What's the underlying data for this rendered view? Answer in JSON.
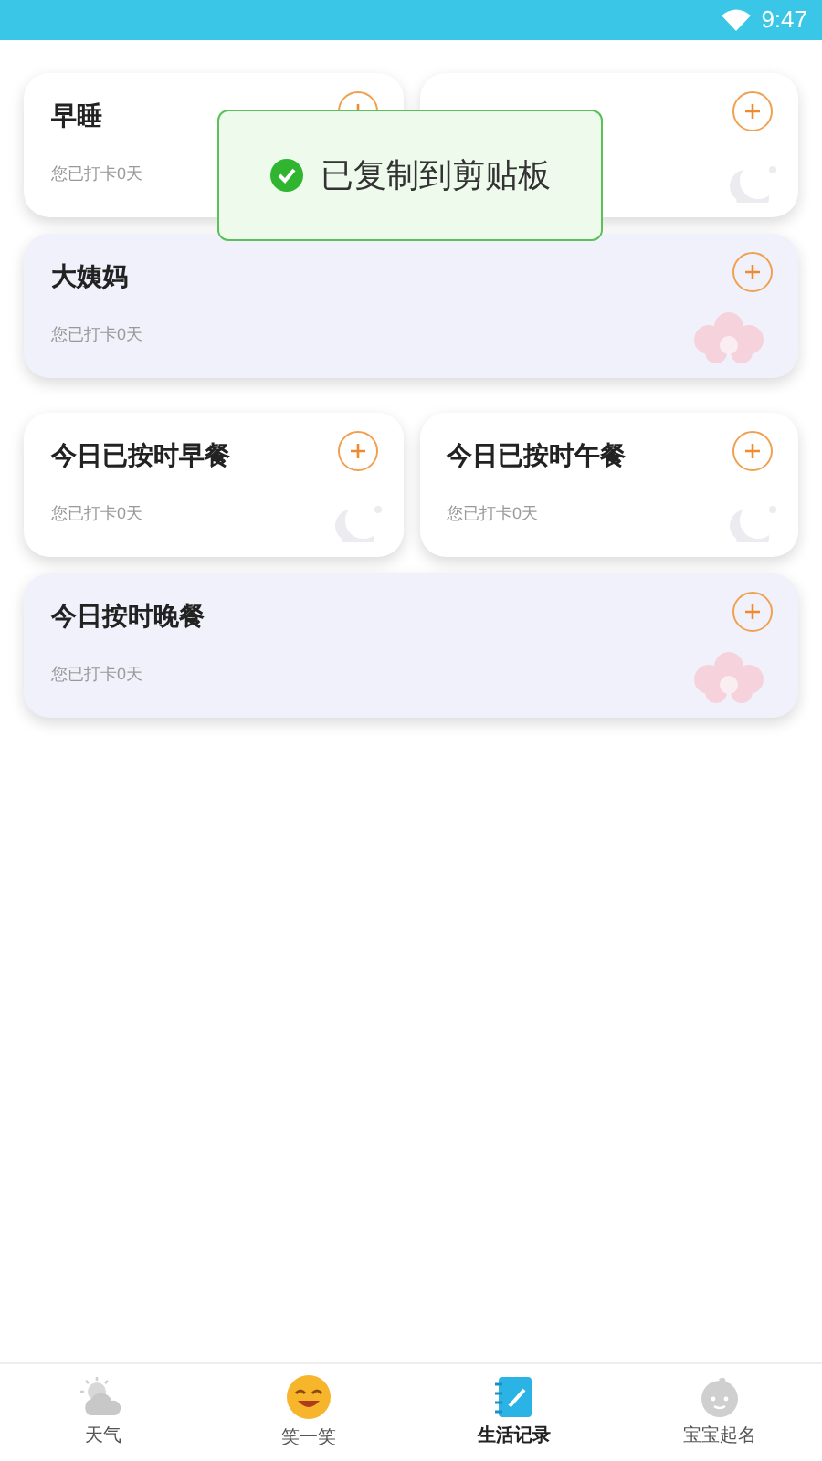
{
  "status_bar": {
    "time": "9:47"
  },
  "card_rows": [
    {
      "cards": [
        {
          "title": "早睡",
          "subtitle": "您已打卡0天",
          "kind": "plain"
        },
        {
          "kind": "moon"
        }
      ]
    },
    {
      "cards": [
        {
          "title": "大姨妈",
          "subtitle": "您已打卡0天",
          "kind": "flower"
        }
      ]
    },
    {
      "cards": [
        {
          "title": "今日已按时早餐",
          "subtitle": "您已打卡0天",
          "kind": "moon"
        },
        {
          "title": "今日已按时午餐",
          "subtitle": "您已打卡0天",
          "kind": "moon"
        }
      ]
    },
    {
      "cards": [
        {
          "title": "今日按时晚餐",
          "subtitle": "您已打卡0天",
          "kind": "flower"
        }
      ]
    }
  ],
  "toast": {
    "text": "已复制到剪贴板"
  },
  "bottom_nav": [
    {
      "label": "天气",
      "kind": "weather",
      "selected": false
    },
    {
      "label": "笑一笑",
      "kind": "smile",
      "selected": false
    },
    {
      "label": "生活记录",
      "kind": "notes",
      "selected": true
    },
    {
      "label": "宝宝起名",
      "kind": "baby",
      "selected": false
    }
  ]
}
